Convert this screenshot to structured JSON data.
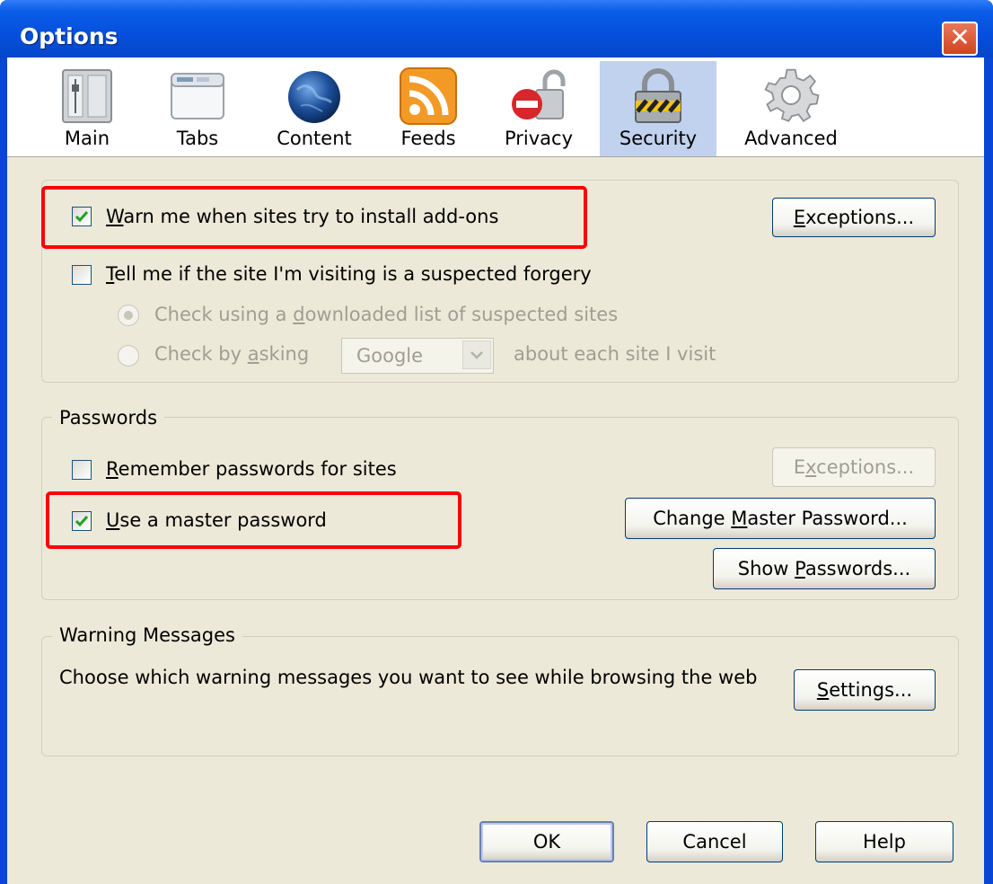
{
  "window": {
    "title": "Options",
    "close_glyph": "✕"
  },
  "toolbar": {
    "panes": [
      {
        "label": "Main",
        "icon": "main-switch-icon",
        "selected": false
      },
      {
        "label": "Tabs",
        "icon": "tabs-window-icon",
        "selected": false
      },
      {
        "label": "Content",
        "icon": "globe-icon",
        "selected": false
      },
      {
        "label": "Feeds",
        "icon": "rss-feed-icon",
        "selected": false
      },
      {
        "label": "Privacy",
        "icon": "privacy-lock-icon",
        "selected": false
      },
      {
        "label": "Security",
        "icon": "padlock-icon",
        "selected": true
      },
      {
        "label": "Advanced",
        "icon": "gear-icon",
        "selected": false
      }
    ]
  },
  "addons": {
    "warn_label_mnemonic": "W",
    "warn_label_rest": "arn me when sites try to install add-ons",
    "warn_checked": true,
    "exceptions_mnemonic": "E",
    "exceptions_rest": "xceptions..."
  },
  "forgery": {
    "tell_label_mnemonic": "T",
    "tell_label_rest": "ell me if the site I'm visiting is a suspected forgery",
    "tell_checked": false,
    "radio_download_before": "Check using a ",
    "radio_download_mnemonic": "d",
    "radio_download_after": "ownloaded list of suspected sites",
    "radio_download_selected": true,
    "radio_ask_before": "Check by ",
    "radio_ask_mnemonic": "a",
    "radio_ask_after": "sking",
    "radio_ask_selected": false,
    "provider_value": "Google",
    "ask_suffix": "about each site I visit"
  },
  "passwords": {
    "legend": "Passwords",
    "remember_mnemonic": "R",
    "remember_rest": "emember passwords for sites",
    "remember_checked": false,
    "exceptions_mnemonic": "x",
    "exceptions_before": "E",
    "exceptions_after": "ceptions...",
    "exceptions_enabled": false,
    "master_mnemonic": "U",
    "master_rest": "se a master password",
    "master_checked": true,
    "change_before": "Change ",
    "change_mnemonic": "M",
    "change_after": "aster Password...",
    "show_before": "Show ",
    "show_mnemonic": "P",
    "show_after": "asswords..."
  },
  "warnings": {
    "legend": "Warning Messages",
    "description": "Choose which warning messages you want to see while browsing the web",
    "settings_mnemonic": "S",
    "settings_rest": "ettings..."
  },
  "footer": {
    "ok": "OK",
    "cancel": "Cancel",
    "help": "Help"
  },
  "colors": {
    "highlight": "#ff0000",
    "selected_pane": "#c1d2ee",
    "titlebar": "#0550dc"
  }
}
